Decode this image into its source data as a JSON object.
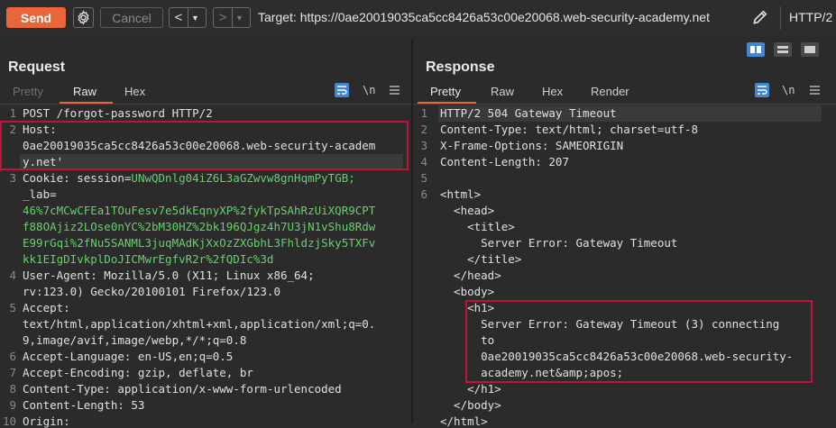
{
  "toolbar": {
    "send_label": "Send",
    "cancel_label": "Cancel",
    "back_glyph": "<",
    "forward_glyph": ">",
    "dropdown_glyph": "▼",
    "target_label": "Target: https://0ae20019035ca5cc8426a53c00e20068.web-security-academy.net",
    "protocol_label": "HTTP/2"
  },
  "icons": {
    "settings": "gear-icon",
    "edit": "pencil-icon",
    "layout": [
      "split-horizontal-icon",
      "split-vertical-icon",
      "single-pane-icon"
    ],
    "pretty_toggle": "wrap-lines-icon",
    "newline_toggle": "\\n",
    "menu": "hamburger-icon"
  },
  "colors": {
    "send": "#e8663a",
    "accent_tab": "#e8663a",
    "highlight_box": "#c2123a",
    "cookie_value": "#66d16a",
    "selected_layout": "#3f86d6"
  },
  "request": {
    "title": "Request",
    "tabs": [
      {
        "label": "Pretty",
        "state": "disabled"
      },
      {
        "label": "Raw",
        "state": "active"
      },
      {
        "label": "Hex",
        "state": "inactive"
      }
    ],
    "newline_label": "\\n",
    "lines": [
      {
        "n": "1",
        "text": "POST /forgot-password HTTP/2"
      },
      {
        "n": "2",
        "text": "Host:"
      },
      {
        "n": "",
        "text": "0ae20019035ca5cc8426a53c00e20068.web-security-academ"
      },
      {
        "n": "",
        "text": "y.net'"
      },
      {
        "n": "3",
        "text": "Cookie: session=",
        "value": "UNwQDnlg04iZ6L3aGZwvw8gnHqmPyTGB;"
      },
      {
        "n": "",
        "text": "_lab="
      },
      {
        "n": "",
        "value": "46%7cMCwCFEa1TOuFesv7e5dkEqnyXP%2fykTpSAhRzUiXQR9CPT"
      },
      {
        "n": "",
        "value": "f88OAjiz2LOse0nYC%2bM30HZ%2bk196QJgz4h7U3jN1vShu8Rdw"
      },
      {
        "n": "",
        "value": "E99rGqi%2fNu5SANML3juqMAdKjXxOzZXGbhL3FhldzjSky5TXFv"
      },
      {
        "n": "",
        "value": "kk1EIgDIvkplDoJICMwrEgfvR2r%2fQDIc%3d"
      },
      {
        "n": "4",
        "text": "User-Agent: Mozilla/5.0 (X11; Linux x86_64;"
      },
      {
        "n": "",
        "text": "rv:123.0) Gecko/20100101 Firefox/123.0"
      },
      {
        "n": "5",
        "text": "Accept:"
      },
      {
        "n": "",
        "text": "text/html,application/xhtml+xml,application/xml;q=0."
      },
      {
        "n": "",
        "text": "9,image/avif,image/webp,*/*;q=0.8"
      },
      {
        "n": "6",
        "text": "Accept-Language: en-US,en;q=0.5"
      },
      {
        "n": "7",
        "text": "Accept-Encoding: gzip, deflate, br"
      },
      {
        "n": "8",
        "text": "Content-Type: application/x-www-form-urlencoded"
      },
      {
        "n": "9",
        "text": "Content-Length: 53"
      },
      {
        "n": "10",
        "text": "Origin:"
      }
    ]
  },
  "response": {
    "title": "Response",
    "tabs": [
      {
        "label": "Pretty",
        "state": "active"
      },
      {
        "label": "Raw",
        "state": "inactive"
      },
      {
        "label": "Hex",
        "state": "inactive"
      },
      {
        "label": "Render",
        "state": "inactive"
      }
    ],
    "newline_label": "\\n",
    "lines": [
      {
        "n": "1",
        "text": "HTTP/2 504 Gateway Timeout"
      },
      {
        "n": "2",
        "text": "Content-Type: text/html; charset=utf-8"
      },
      {
        "n": "3",
        "text": "X-Frame-Options: SAMEORIGIN"
      },
      {
        "n": "4",
        "text": "Content-Length: 207"
      },
      {
        "n": "5",
        "text": ""
      },
      {
        "n": "6",
        "text": "<html>"
      },
      {
        "n": "",
        "text": "  <head>"
      },
      {
        "n": "",
        "text": "    <title>"
      },
      {
        "n": "",
        "text": "      Server Error: Gateway Timeout"
      },
      {
        "n": "",
        "text": "    </title>"
      },
      {
        "n": "",
        "text": "  </head>"
      },
      {
        "n": "",
        "text": "  <body>"
      },
      {
        "n": "",
        "text": "    <h1>"
      },
      {
        "n": "",
        "text": "      Server Error: Gateway Timeout (3) connecting"
      },
      {
        "n": "",
        "text": "      to"
      },
      {
        "n": "",
        "text": "      0ae20019035ca5cc8426a53c00e20068.web-security-"
      },
      {
        "n": "",
        "text": "      academy.net&amp;apos;"
      },
      {
        "n": "",
        "text": "    </h1>"
      },
      {
        "n": "",
        "text": "  </body>"
      },
      {
        "n": "",
        "text": "</html>"
      }
    ]
  }
}
